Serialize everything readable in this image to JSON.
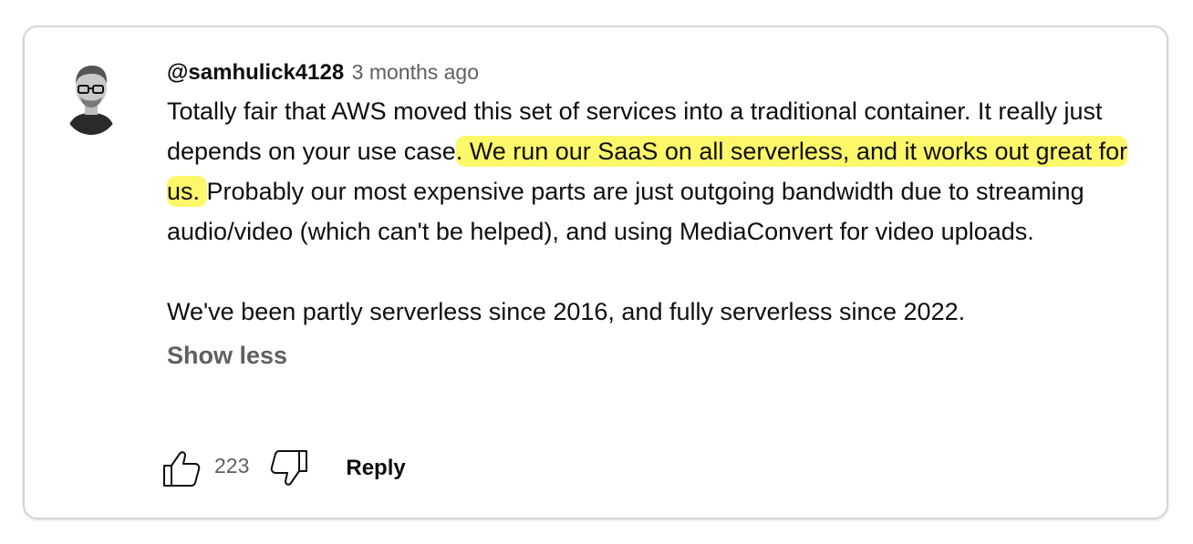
{
  "comment": {
    "author": "@samhulick4128",
    "timestamp": "3 months ago",
    "body": {
      "p1_before": "Totally fair that AWS moved this set of services into a traditional container. It really just depends on your use case",
      "p1_highlight": ". We run our SaaS on all serverless, and it works out great for us. ",
      "p1_after": "Probably our most expensive parts are just outgoing bandwidth due to streaming audio/video (which can't be helped), and using MediaConvert for video uploads.",
      "p2": "We've been partly serverless since 2016, and fully serverless since 2022."
    },
    "show_less_label": "Show less",
    "like_count": "223",
    "reply_label": "Reply",
    "highlight_color": "#fdf86a"
  },
  "icons": {
    "like": "thumbs-up-icon",
    "dislike": "thumbs-down-icon"
  }
}
